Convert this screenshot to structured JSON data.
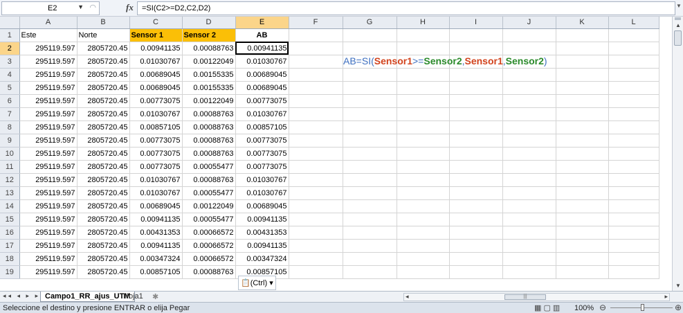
{
  "formula_bar": {
    "name_box": "E2",
    "fx": "fx",
    "formula": "=SI(C2>=D2,C2,D2)"
  },
  "columns": [
    "A",
    "B",
    "C",
    "D",
    "E",
    "F",
    "G",
    "H",
    "I",
    "J",
    "K",
    "L"
  ],
  "header_row": {
    "row": "1",
    "a": "Este",
    "b": "Norte",
    "c": "Sensor 1",
    "d": "Sensor 2",
    "e": "AB"
  },
  "rows": [
    {
      "n": "2",
      "a": "295119.597",
      "b": "2805720.45",
      "c": "0.00941135",
      "d": "0.00088763",
      "e": "0.00941135"
    },
    {
      "n": "3",
      "a": "295119.597",
      "b": "2805720.45",
      "c": "0.01030767",
      "d": "0.00122049",
      "e": "0.01030767"
    },
    {
      "n": "4",
      "a": "295119.597",
      "b": "2805720.45",
      "c": "0.00689045",
      "d": "0.00155335",
      "e": "0.00689045"
    },
    {
      "n": "5",
      "a": "295119.597",
      "b": "2805720.45",
      "c": "0.00689045",
      "d": "0.00155335",
      "e": "0.00689045"
    },
    {
      "n": "6",
      "a": "295119.597",
      "b": "2805720.45",
      "c": "0.00773075",
      "d": "0.00122049",
      "e": "0.00773075"
    },
    {
      "n": "7",
      "a": "295119.597",
      "b": "2805720.45",
      "c": "0.01030767",
      "d": "0.00088763",
      "e": "0.01030767"
    },
    {
      "n": "8",
      "a": "295119.597",
      "b": "2805720.45",
      "c": "0.00857105",
      "d": "0.00088763",
      "e": "0.00857105"
    },
    {
      "n": "9",
      "a": "295119.597",
      "b": "2805720.45",
      "c": "0.00773075",
      "d": "0.00088763",
      "e": "0.00773075"
    },
    {
      "n": "10",
      "a": "295119.597",
      "b": "2805720.45",
      "c": "0.00773075",
      "d": "0.00088763",
      "e": "0.00773075"
    },
    {
      "n": "11",
      "a": "295119.597",
      "b": "2805720.45",
      "c": "0.00773075",
      "d": "0.00055477",
      "e": "0.00773075"
    },
    {
      "n": "12",
      "a": "295119.597",
      "b": "2805720.45",
      "c": "0.01030767",
      "d": "0.00088763",
      "e": "0.01030767"
    },
    {
      "n": "13",
      "a": "295119.597",
      "b": "2805720.45",
      "c": "0.01030767",
      "d": "0.00055477",
      "e": "0.01030767"
    },
    {
      "n": "14",
      "a": "295119.597",
      "b": "2805720.45",
      "c": "0.00689045",
      "d": "0.00122049",
      "e": "0.00689045"
    },
    {
      "n": "15",
      "a": "295119.597",
      "b": "2805720.45",
      "c": "0.00941135",
      "d": "0.00055477",
      "e": "0.00941135"
    },
    {
      "n": "16",
      "a": "295119.597",
      "b": "2805720.45",
      "c": "0.00431353",
      "d": "0.00066572",
      "e": "0.00431353"
    },
    {
      "n": "17",
      "a": "295119.597",
      "b": "2805720.45",
      "c": "0.00941135",
      "d": "0.00066572",
      "e": "0.00941135"
    },
    {
      "n": "18",
      "a": "295119.597",
      "b": "2805720.45",
      "c": "0.00347324",
      "d": "0.00066572",
      "e": "0.00347324"
    },
    {
      "n": "19",
      "a": "295119.597",
      "b": "2805720.45",
      "c": "0.00857105",
      "d": "0.00088763",
      "e": "0.00857105"
    }
  ],
  "annotation": {
    "prefix": "AB=",
    "fn": "SI(",
    "s1": "Sensor1",
    "op": ">=",
    "s2": "Sensor2",
    "c1": ",",
    "s3": "Sensor1",
    "c2": ",",
    "s4": "Sensor2",
    "close": ")"
  },
  "paste_options": {
    "label": "(Ctrl)"
  },
  "sheet_tabs": [
    "Campo1_RR_ajus_UTM",
    "Hoja1"
  ],
  "status_bar": {
    "message": "Seleccione el destino y presione ENTRAR o elija Pegar",
    "zoom": "100%"
  },
  "colors": {
    "sensor_header_fill": "#fbbf07",
    "selection_header": "#fbd58a",
    "annotation_red": "#d2431d",
    "annotation_green": "#2a8a2a",
    "annotation_blue": "#3d6fc0"
  }
}
